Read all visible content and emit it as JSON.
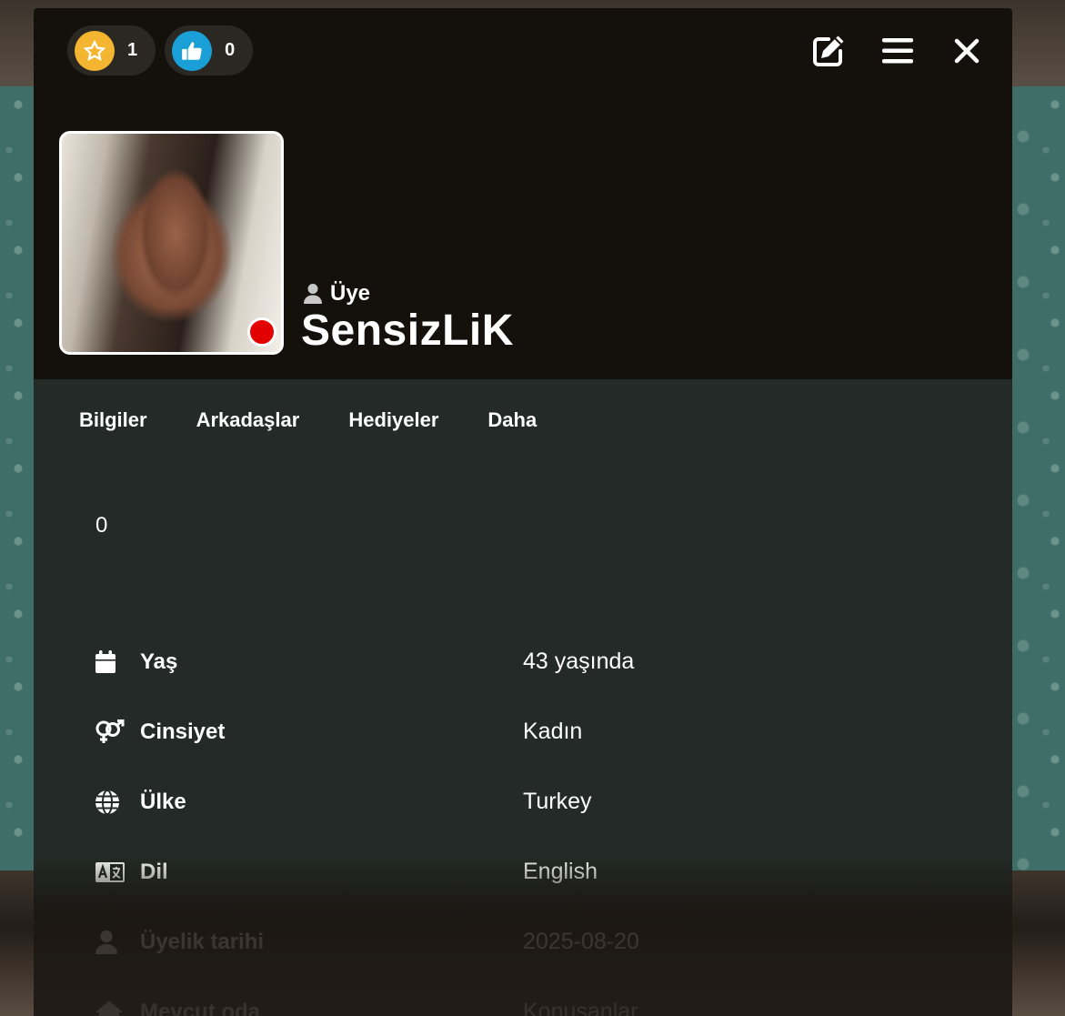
{
  "badges": [
    {
      "icon": "star-icon",
      "count": "1",
      "color": "#f4b630"
    },
    {
      "icon": "thumbs-up-icon",
      "count": "0",
      "color": "#1aa0d6"
    }
  ],
  "actions": [
    "edit-icon",
    "menu-icon",
    "close-icon"
  ],
  "profile": {
    "role": "Üye",
    "username": "SensizLiK",
    "status_color": "#e30000"
  },
  "tabs": [
    "Bilgiler",
    "Arkadaşlar",
    "Hediyeler",
    "Daha"
  ],
  "counter": "0",
  "info": [
    {
      "icon": "calendar-icon",
      "label": "Yaş",
      "value": "43 yaşında"
    },
    {
      "icon": "gender-icon",
      "label": "Cinsiyet",
      "value": "Kadın"
    },
    {
      "icon": "globe-icon",
      "label": "Ülke",
      "value": "Turkey"
    },
    {
      "icon": "language-icon",
      "label": "Dil",
      "value": "English"
    },
    {
      "icon": "user-icon",
      "label": "Üyelik tarihi",
      "value": "2025-08-20"
    },
    {
      "icon": "home-icon",
      "label": "Mevcut oda",
      "value": "Konusanlar"
    }
  ]
}
